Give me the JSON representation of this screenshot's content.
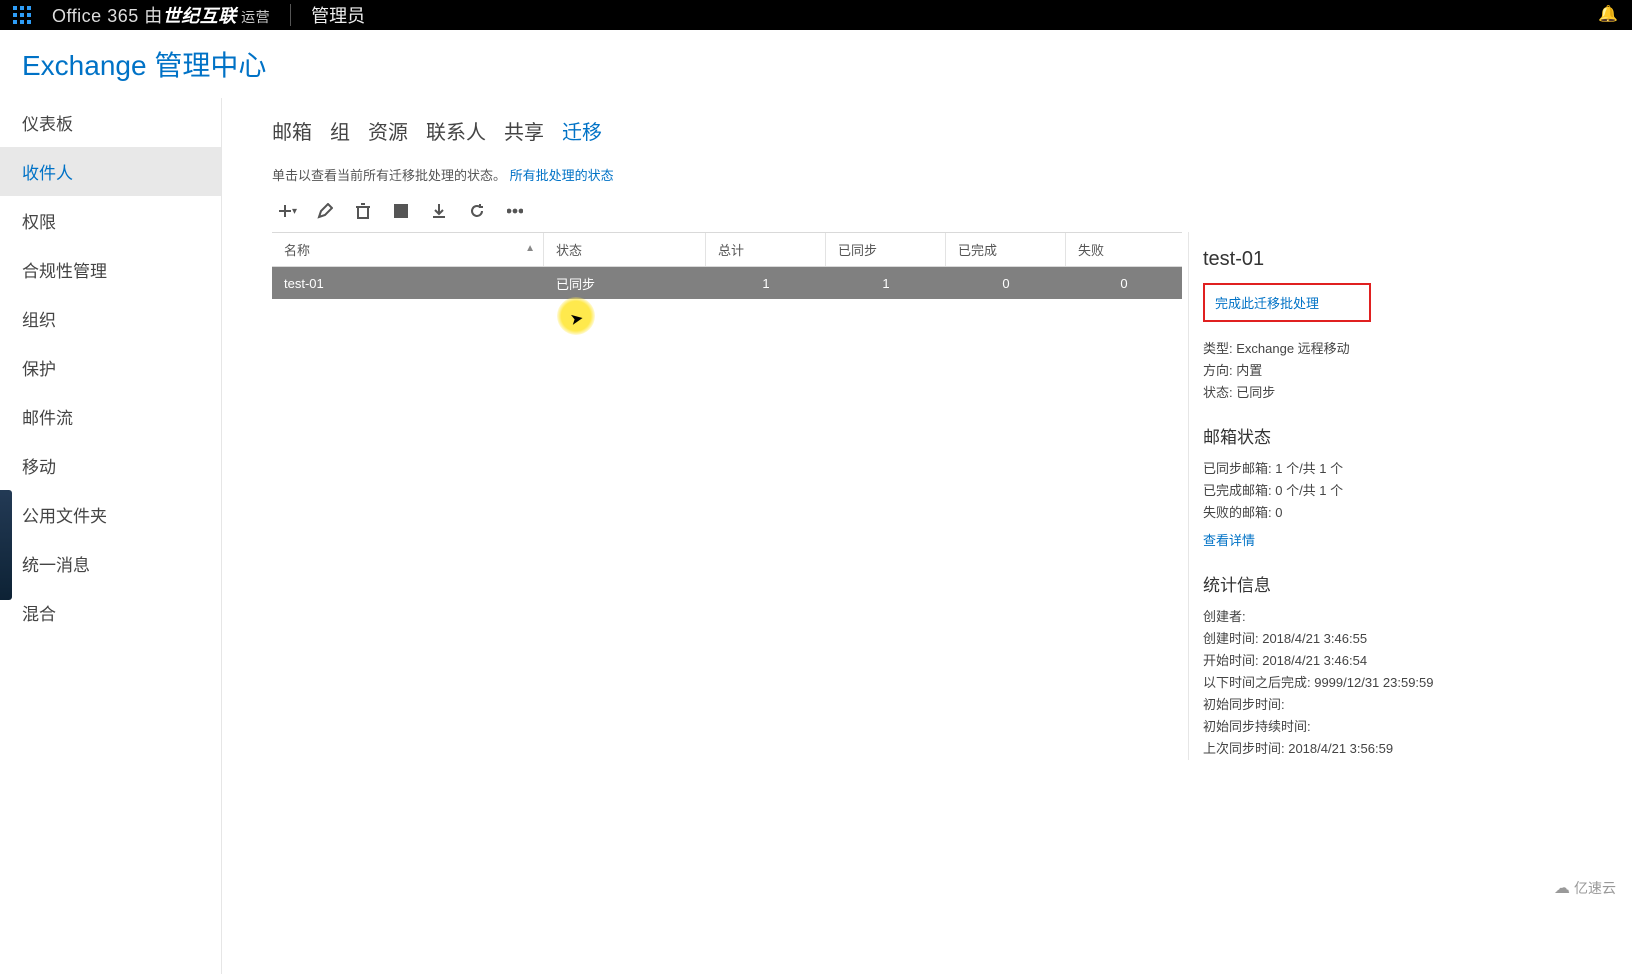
{
  "topbar": {
    "brand_prefix": "Office 365 由",
    "brand_bold": "世纪互联",
    "brand_suffix": " 运营",
    "admin": "管理员"
  },
  "page_title": "Exchange 管理中心",
  "sidebar": {
    "items": [
      {
        "label": "仪表板"
      },
      {
        "label": "收件人",
        "active": true
      },
      {
        "label": "权限"
      },
      {
        "label": "合规性管理"
      },
      {
        "label": "组织"
      },
      {
        "label": "保护"
      },
      {
        "label": "邮件流"
      },
      {
        "label": "移动"
      },
      {
        "label": "公用文件夹"
      },
      {
        "label": "统一消息"
      },
      {
        "label": "混合"
      }
    ]
  },
  "tabs": [
    {
      "label": "邮箱"
    },
    {
      "label": "组"
    },
    {
      "label": "资源"
    },
    {
      "label": "联系人"
    },
    {
      "label": "共享"
    },
    {
      "label": "迁移",
      "active": true
    }
  ],
  "hint": {
    "text": "单击以查看当前所有迁移批处理的状态。",
    "link": "所有批处理的状态"
  },
  "columns": {
    "name": "名称",
    "status": "状态",
    "total": "总计",
    "synced": "已同步",
    "done": "已完成",
    "failed": "失败"
  },
  "rows": [
    {
      "name": "test-01",
      "status": "已同步",
      "total": "1",
      "synced": "1",
      "done": "0",
      "failed": "0"
    }
  ],
  "detail": {
    "title": "test-01",
    "complete_link": "完成此迁移批处理",
    "type_label": "类型:",
    "type_value": "Exchange 远程移动",
    "dir_label": "方向:",
    "dir_value": "内置",
    "status_label": "状态:",
    "status_value": "已同步",
    "mailbox_section": "邮箱状态",
    "mb_synced": "已同步邮箱: 1 个/共 1 个",
    "mb_done": "已完成邮箱: 0 个/共 1 个",
    "mb_failed": "失败的邮箱: 0",
    "view_details": "查看详情",
    "stats_section": "统计信息",
    "creator": "创建者:",
    "created": "创建时间: 2018/4/21 3:46:55",
    "started": "开始时间: 2018/4/21 3:46:54",
    "finish_after": "以下时间之后完成: 9999/12/31 23:59:59",
    "init_sync": "初始同步时间:",
    "init_sync_dur": "初始同步持续时间:",
    "last_sync": "上次同步时间: 2018/4/21 3:56:59"
  },
  "watermark": "亿速云"
}
